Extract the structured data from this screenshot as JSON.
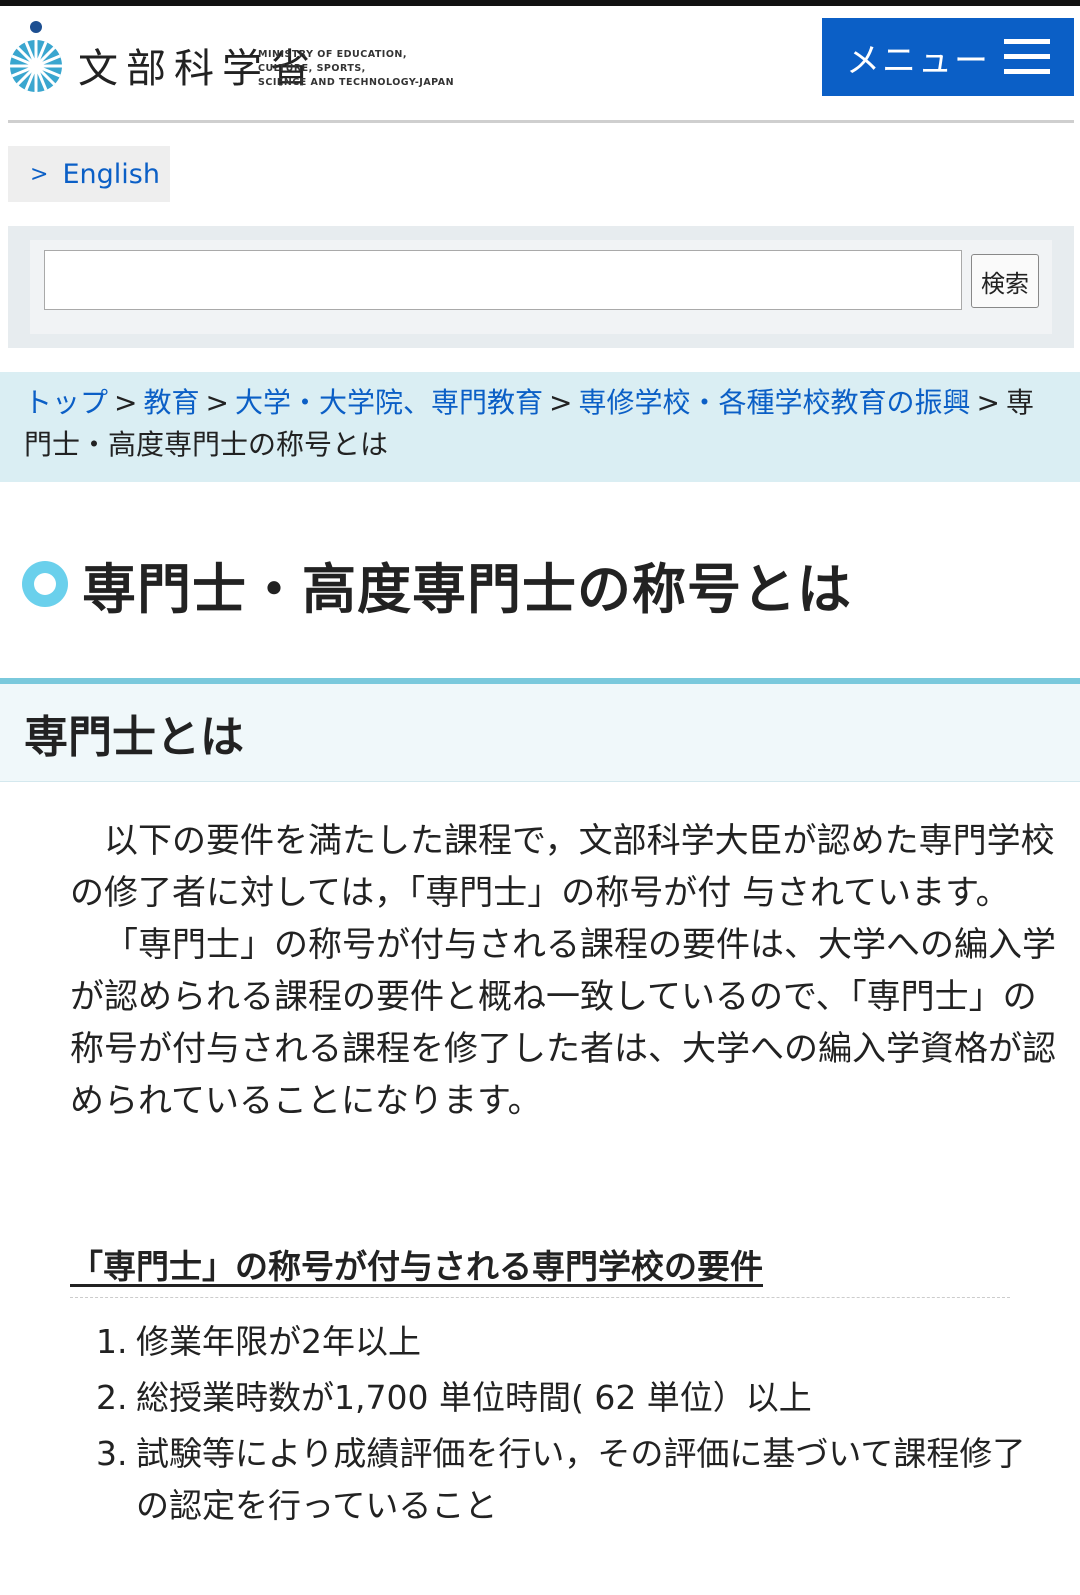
{
  "header": {
    "logo_ja": "文部科学省",
    "logo_en": [
      "MINISTRY OF EDUCATION,",
      "CULTURE, SPORTS,",
      "SCIENCE AND TECHNOLOGY-JAPAN"
    ],
    "menu_label": "メニュー"
  },
  "lang_link": {
    "chevron": ">",
    "label": "English"
  },
  "search": {
    "value": "",
    "button_label": "検索"
  },
  "breadcrumb": {
    "items": [
      "トップ",
      "教育",
      "大学・大学院、専門教育",
      "専修学校・各種学校教育の振興"
    ],
    "separator": ">",
    "current": "専門士・高度専門士の称号とは"
  },
  "page_title": "専門士・高度専門士の称号とは",
  "section": {
    "heading": "専門士とは",
    "paragraphs": [
      "以下の要件を満たした課程で，文部科学大臣が認めた専門学校の修了者に対しては，「専門士」の称号が付 与されています。",
      "「専門士」の称号が付与される課程の要件は、大学への編入学が認められる課程の要件と概ね一致しているので、「専門士」の称号が付与される課程を修了した者は、大学への編入学資格が認められていることになります。"
    ],
    "requirements_heading": "「専門士」の称号が付与される専門学校の要件",
    "requirements": [
      {
        "num": "1.",
        "text": "修業年限が2年以上"
      },
      {
        "num": "2.",
        "text": "総授業時数が1,700 単位時間( 62 単位）以上"
      },
      {
        "num": "3.",
        "text": "試験等により成績評価を行い，その評価に基づいて課程修了の認定を行っていること"
      }
    ]
  },
  "colors": {
    "accent_blue": "#0b5fc6",
    "breadcrumb_bg": "#daeef3",
    "title_icon": "#6ad0ec",
    "section_border": "#7ac9dc"
  }
}
